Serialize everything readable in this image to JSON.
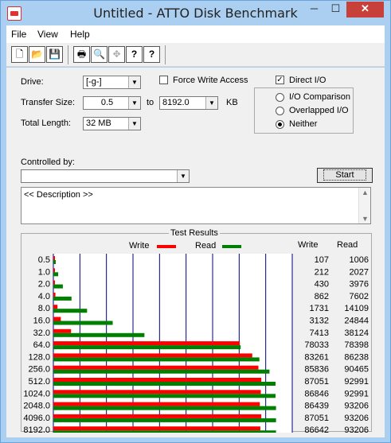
{
  "window": {
    "title": "Untitled - ATTO Disk Benchmark",
    "controls": {
      "minimize": "─",
      "maximize": "☐",
      "close": "✕"
    }
  },
  "menu": [
    "File",
    "View",
    "Help"
  ],
  "toolbar": {
    "icons": [
      "new-icon",
      "open-icon",
      "save-icon",
      "print-icon",
      "print-preview-icon",
      "move-icon",
      "help-icon",
      "context-help-icon"
    ],
    "glyphs": [
      "🗋",
      "📂",
      "💾",
      "🖶",
      "🔍",
      "✥",
      "?",
      "?"
    ]
  },
  "settings": {
    "drive_label": "Drive:",
    "drive_value": "[-g-]",
    "force_write_label": "Force Write Access",
    "force_write_checked": false,
    "direct_io_label": "Direct I/O",
    "direct_io_checked": true,
    "transfer_size_label": "Transfer Size:",
    "transfer_from": "0.5",
    "transfer_to_label": "to",
    "transfer_to": "8192.0",
    "transfer_unit": "KB",
    "total_length_label": "Total Length:",
    "total_length_value": "32 MB",
    "io_options": [
      {
        "label": "I/O Comparison",
        "selected": false
      },
      {
        "label": "Overlapped I/O",
        "selected": false
      },
      {
        "label": "Neither",
        "selected": true
      }
    ],
    "controlled_by_label": "Controlled by:",
    "controlled_by_value": "",
    "start_label": "Start",
    "description_text": "<< Description >>"
  },
  "results": {
    "title": "Test Results",
    "legend_write": "Write",
    "legend_read": "Read",
    "col_write": "Write",
    "col_read": "Read",
    "write_color": "#ff0000",
    "read_color": "#008000",
    "grid_color": "#000080"
  },
  "chart_data": {
    "type": "bar",
    "orientation": "horizontal",
    "title": "Test Results",
    "categories": [
      "0.5",
      "1.0",
      "2.0",
      "4.0",
      "8.0",
      "16.0",
      "32.0",
      "64.0",
      "128.0",
      "256.0",
      "512.0",
      "1024.0",
      "2048.0",
      "4096.0",
      "8192.0"
    ],
    "series": [
      {
        "name": "Write",
        "color": "#ff0000",
        "values": [
          107,
          212,
          430,
          862,
          1731,
          3132,
          7413,
          78033,
          83261,
          85836,
          87051,
          86846,
          86439,
          87051,
          86642
        ]
      },
      {
        "name": "Read",
        "color": "#008000",
        "values": [
          1006,
          2027,
          3976,
          7602,
          14109,
          24844,
          38124,
          78398,
          86238,
          90465,
          92991,
          92991,
          93206,
          93206,
          93206
        ]
      }
    ],
    "xlim": [
      0,
      100000
    ],
    "grid": true,
    "grid_lines": 9
  }
}
